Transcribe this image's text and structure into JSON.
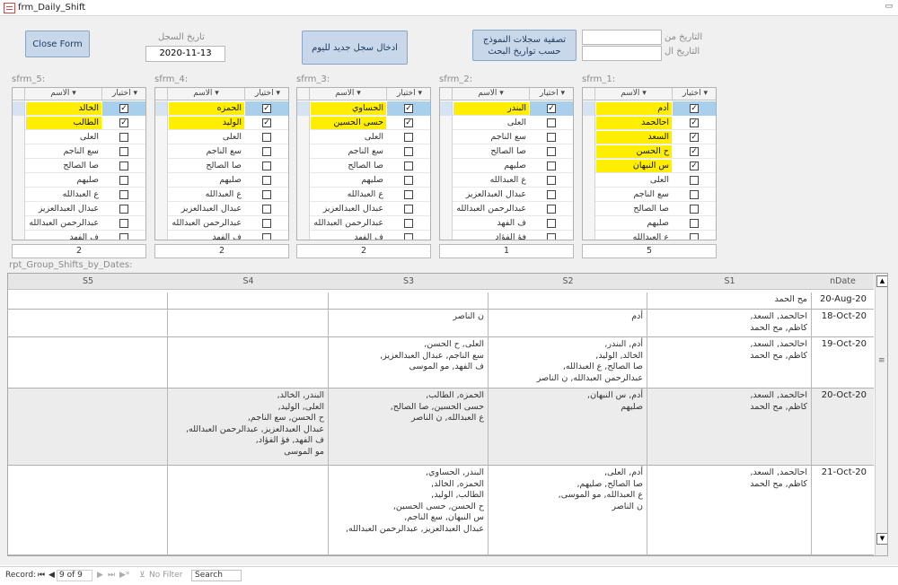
{
  "window": {
    "title": "frm_Daily_Shift"
  },
  "buttons": {
    "close": "Close Form",
    "new_record": "ادخال سجل جديد لليوم",
    "filter_line1": "تصفية سجلات النموذج",
    "filter_line2": "حسب تواريخ البحث"
  },
  "record_date": {
    "label": "تاريخ السجل",
    "value": "2020-11-13"
  },
  "search_dates": {
    "from_label": "التاريخ من",
    "to_label": "التاريخ ال",
    "from_value": "",
    "to_value": ""
  },
  "subforms": [
    {
      "label": "sfrm_5:",
      "col_choose": "اختيار",
      "col_name": "الاسم",
      "count": "2",
      "rows": [
        {
          "name": "الخالد",
          "checked": true,
          "highlight": true
        },
        {
          "name": "الطالب",
          "checked": true,
          "highlight": true
        },
        {
          "name": "العلى",
          "checked": false,
          "highlight": false
        },
        {
          "name": "سع الناجم",
          "checked": false,
          "highlight": false
        },
        {
          "name": "صا الصالح",
          "checked": false,
          "highlight": false
        },
        {
          "name": "صليهم",
          "checked": false,
          "highlight": false
        },
        {
          "name": "ع العبدالله",
          "checked": false,
          "highlight": false
        },
        {
          "name": "عبدال العبدالعزيز",
          "checked": false,
          "highlight": false
        },
        {
          "name": "عبدالرحمن العبدالله",
          "checked": false,
          "highlight": false
        },
        {
          "name": "ف الفهد",
          "checked": false,
          "highlight": false
        }
      ]
    },
    {
      "label": "sfrm_4:",
      "col_choose": "اختيار",
      "col_name": "الاسم",
      "count": "2",
      "rows": [
        {
          "name": "الحمزه",
          "checked": true,
          "highlight": true
        },
        {
          "name": "الوليد",
          "checked": true,
          "highlight": true
        },
        {
          "name": "العلى",
          "checked": false,
          "highlight": false
        },
        {
          "name": "سع الناجم",
          "checked": false,
          "highlight": false
        },
        {
          "name": "صا الصالح",
          "checked": false,
          "highlight": false
        },
        {
          "name": "صليهم",
          "checked": false,
          "highlight": false
        },
        {
          "name": "ع العبدالله",
          "checked": false,
          "highlight": false
        },
        {
          "name": "عبدال العبدالعزيز",
          "checked": false,
          "highlight": false
        },
        {
          "name": "عبدالرحمن العبدالله",
          "checked": false,
          "highlight": false
        },
        {
          "name": "ف الفهد",
          "checked": false,
          "highlight": false
        }
      ]
    },
    {
      "label": "sfrm_3:",
      "col_choose": "اختيار",
      "col_name": "الاسم",
      "count": "2",
      "rows": [
        {
          "name": "الحساوي",
          "checked": true,
          "highlight": true
        },
        {
          "name": "حسى الحسين",
          "checked": true,
          "highlight": true
        },
        {
          "name": "العلى",
          "checked": false,
          "highlight": false
        },
        {
          "name": "سع الناجم",
          "checked": false,
          "highlight": false
        },
        {
          "name": "صا الصالح",
          "checked": false,
          "highlight": false
        },
        {
          "name": "صليهم",
          "checked": false,
          "highlight": false
        },
        {
          "name": "ع العبدالله",
          "checked": false,
          "highlight": false
        },
        {
          "name": "عبدال العبدالعزيز",
          "checked": false,
          "highlight": false
        },
        {
          "name": "عبدالرحمن العبدالله",
          "checked": false,
          "highlight": false
        },
        {
          "name": "ف الفهد",
          "checked": false,
          "highlight": false
        }
      ]
    },
    {
      "label": "sfrm_2:",
      "col_choose": "اختيار",
      "col_name": "الاسم",
      "count": "1",
      "rows": [
        {
          "name": "البندر",
          "checked": true,
          "highlight": true
        },
        {
          "name": "العلى",
          "checked": false,
          "highlight": false
        },
        {
          "name": "سع الناجم",
          "checked": false,
          "highlight": false
        },
        {
          "name": "صا الصالح",
          "checked": false,
          "highlight": false
        },
        {
          "name": "صليهم",
          "checked": false,
          "highlight": false
        },
        {
          "name": "ع العبدالله",
          "checked": false,
          "highlight": false
        },
        {
          "name": "عبدال العبدالعزيز",
          "checked": false,
          "highlight": false
        },
        {
          "name": "عبدالرحمن العبدالله",
          "checked": false,
          "highlight": false
        },
        {
          "name": "ف الفهد",
          "checked": false,
          "highlight": false
        },
        {
          "name": "فؤ الفؤاد",
          "checked": false,
          "highlight": false
        }
      ]
    },
    {
      "label": "sfrm_1:",
      "col_choose": "اختيار",
      "col_name": "الاسم",
      "count": "5",
      "rows": [
        {
          "name": "أدم",
          "checked": true,
          "highlight": true
        },
        {
          "name": "احالحمد",
          "checked": true,
          "highlight": true
        },
        {
          "name": "السعد",
          "checked": true,
          "highlight": true
        },
        {
          "name": "ح الحسن",
          "checked": true,
          "highlight": true
        },
        {
          "name": "س النبهان",
          "checked": true,
          "highlight": true
        },
        {
          "name": "العلى",
          "checked": false,
          "highlight": false
        },
        {
          "name": "سع الناجم",
          "checked": false,
          "highlight": false
        },
        {
          "name": "صا الصالح",
          "checked": false,
          "highlight": false
        },
        {
          "name": "صليهم",
          "checked": false,
          "highlight": false
        },
        {
          "name": "ع العبدالله",
          "checked": false,
          "highlight": false
        }
      ]
    }
  ],
  "report": {
    "label": "rpt_Group_Shifts_by_Dates:",
    "columns": [
      "S5",
      "S4",
      "S3",
      "S2",
      "S1",
      "nDate"
    ],
    "rows": [
      {
        "date": "20-Aug-20",
        "s1": [
          "مح الحمد"
        ],
        "s2": [],
        "s3": [],
        "s4": [],
        "s5": []
      },
      {
        "date": "18-Oct-20",
        "s1": [
          "احالحمد, السعد,",
          "كاظم, مح الحمد"
        ],
        "s2": [
          "أدم"
        ],
        "s3": [
          "ن الناصر"
        ],
        "s4": [],
        "s5": []
      },
      {
        "date": "19-Oct-20",
        "s1": [
          "احالحمد, السعد,",
          "كاظم, مح الحمد"
        ],
        "s2": [
          "أدم, البندر,",
          "الخالد, الوليد,",
          "صا الصالح, ع العبدالله,",
          "عبدالرحمن العبدالله, ن الناصر"
        ],
        "s3": [
          "العلى, ح الحسن,",
          "سع الناجم, عبدال العبدالعزيز,",
          "ف الفهد, مو الموسى"
        ],
        "s4": [],
        "s5": []
      },
      {
        "date": "20-Oct-20",
        "s1": [
          "احالحمد, السعد,",
          "كاظم, مح الحمد"
        ],
        "s2": [
          "أدم, س النبهان,",
          "صليهم"
        ],
        "s3": [
          "الحمزه, الطالب,",
          "حسى الحسين, صا الصالح,",
          "ع العبدالله, ن الناصر"
        ],
        "s4": [
          "البندر, الخالد,",
          "العلى, الوليد,",
          "ح الحسن, سع الناجم,",
          "عبدال العبدالعزيز, عبدالرحمن العبدالله,",
          "ف الفهد, فؤ الفؤاد,",
          "مو الموسى"
        ],
        "s5": []
      },
      {
        "date": "21-Oct-20",
        "s1": [
          "احالحمد, السعد,",
          "كاظم, مح الحمد"
        ],
        "s2": [
          "أدم, العلى,",
          "صا الصالح, صليهم,",
          "ع العبدالله, مو الموسى,",
          "ن الناصر"
        ],
        "s3": [
          "البندر, الحساوي,",
          "الحمزه, الخالد,",
          "الطالب, الوليد,",
          "ح الحسن, حسى الحسين,",
          "س النبهان, سع الناجم,",
          "عبدال العبدالعزيز, عبدالرحمن العبدالله,"
        ],
        "s4": [],
        "s5": []
      }
    ]
  },
  "navigation": {
    "record_label": "Record:",
    "record_value": "9 of 9",
    "no_filter": "No Filter",
    "search": "Search"
  },
  "icons": [
    "form-icon",
    "minimize-icon",
    "dropdown-arrow-icon",
    "checkbox-icon",
    "scroll-up-icon",
    "scroll-down-icon",
    "first-record-icon",
    "prev-record-icon",
    "next-record-icon",
    "last-record-icon",
    "new-record-icon",
    "filter-icon"
  ]
}
